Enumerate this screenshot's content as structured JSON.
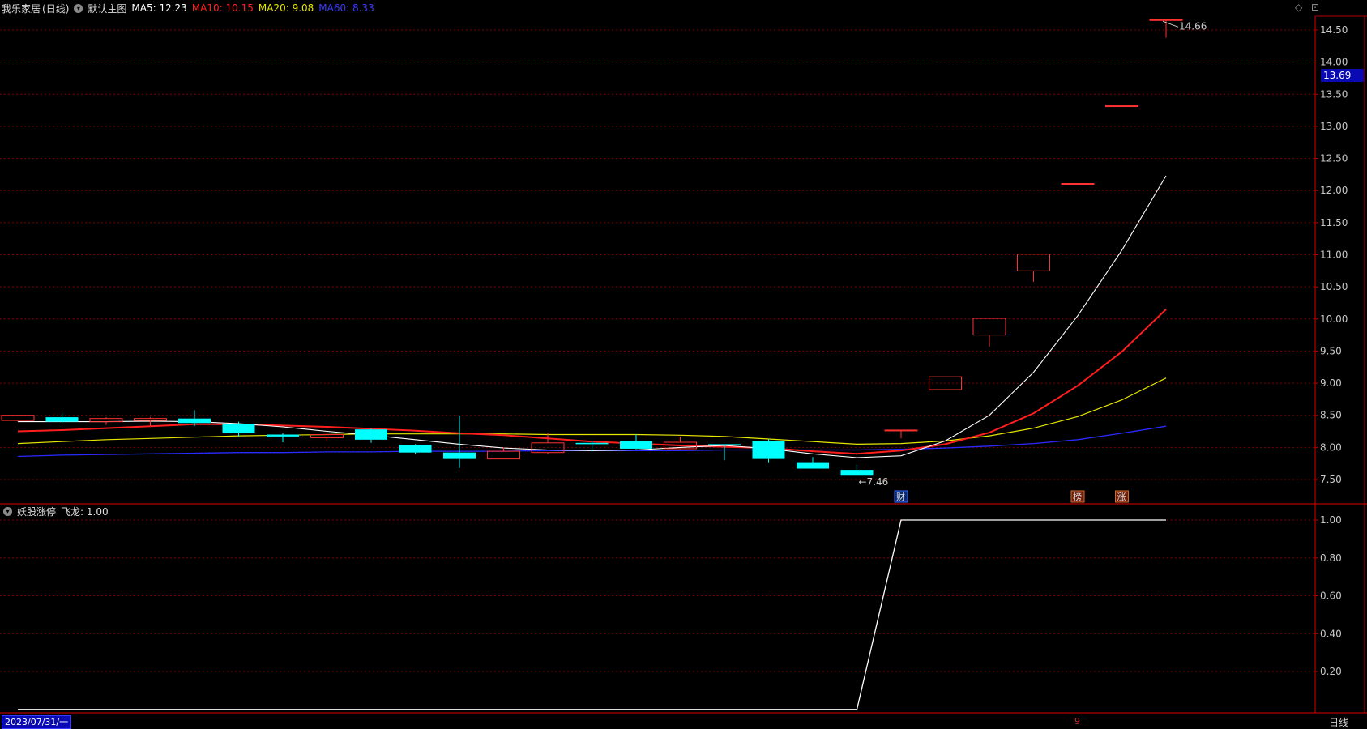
{
  "header": {
    "stock": "我乐家居",
    "period": "(日线)",
    "template": "默认主图",
    "ma5": "MA5: 12.23",
    "ma10": "MA10: 10.15",
    "ma20": "MA20: 9.08",
    "ma60": "MA60: 8.33"
  },
  "sub_header": {
    "indicator": "妖股涨停",
    "value": "飞龙: 1.00"
  },
  "corner_icons": {
    "left": "◇",
    "right": "⊡"
  },
  "current_price": "13.69",
  "footer": {
    "date": "2023/07/31/一",
    "period_label": "日线",
    "marker": "9"
  },
  "colors": {
    "up": "#ff3232",
    "down": "#00ffff",
    "ma5": "#ffffff",
    "ma10": "#ff1e1e",
    "ma20": "#e6e600",
    "ma60": "#2a2aff",
    "grid": "#7a0000",
    "border": "#b40000"
  },
  "chart_data": [
    {
      "type": "candlestick",
      "title": "我乐家居 (日线)",
      "ylim": [
        7.2,
        14.8
      ],
      "yticks": [
        "14.50",
        "14.00",
        "13.50",
        "13.00",
        "12.50",
        "12.00",
        "11.50",
        "11.00",
        "10.50",
        "10.00",
        "9.50",
        "9.00",
        "8.50",
        "8.00",
        "7.50"
      ],
      "candles": [
        {
          "o": 8.42,
          "h": 8.5,
          "l": 8.4,
          "c": 8.5
        },
        {
          "o": 8.47,
          "h": 8.53,
          "l": 8.38,
          "c": 8.4
        },
        {
          "o": 8.4,
          "h": 8.47,
          "l": 8.35,
          "c": 8.45
        },
        {
          "o": 8.42,
          "h": 8.47,
          "l": 8.33,
          "c": 8.45
        },
        {
          "o": 8.45,
          "h": 8.58,
          "l": 8.33,
          "c": 8.38
        },
        {
          "o": 8.37,
          "h": 8.4,
          "l": 8.17,
          "c": 8.22
        },
        {
          "o": 8.2,
          "h": 8.22,
          "l": 8.08,
          "c": 8.17
        },
        {
          "o": 8.15,
          "h": 8.23,
          "l": 8.1,
          "c": 8.2
        },
        {
          "o": 8.28,
          "h": 8.3,
          "l": 8.07,
          "c": 8.12
        },
        {
          "o": 8.04,
          "h": 8.05,
          "l": 7.9,
          "c": 7.92
        },
        {
          "o": 7.92,
          "h": 8.5,
          "l": 7.68,
          "c": 7.82
        },
        {
          "o": 7.82,
          "h": 8.0,
          "l": 7.82,
          "c": 7.94
        },
        {
          "o": 7.92,
          "h": 8.23,
          "l": 7.9,
          "c": 8.07
        },
        {
          "o": 8.07,
          "h": 8.1,
          "l": 7.93,
          "c": 8.05
        },
        {
          "o": 8.1,
          "h": 8.2,
          "l": 7.97,
          "c": 7.98
        },
        {
          "o": 7.98,
          "h": 8.17,
          "l": 7.97,
          "c": 8.08
        },
        {
          "o": 8.05,
          "h": 8.05,
          "l": 7.8,
          "c": 8.03
        },
        {
          "o": 8.1,
          "h": 8.13,
          "l": 7.77,
          "c": 7.82
        },
        {
          "o": 7.77,
          "h": 7.85,
          "l": 7.67,
          "c": 7.67
        },
        {
          "o": 7.65,
          "h": 7.73,
          "l": 7.56,
          "c": 7.56
        },
        {
          "o": 8.27,
          "h": 8.27,
          "l": 8.14,
          "c": 8.27
        },
        {
          "o": 8.9,
          "h": 9.1,
          "l": 8.9,
          "c": 9.1
        },
        {
          "o": 9.75,
          "h": 10.01,
          "l": 9.57,
          "c": 10.01
        },
        {
          "o": 10.75,
          "h": 11.01,
          "l": 10.58,
          "c": 11.01
        },
        {
          "o": 12.11,
          "h": 12.11,
          "l": 12.11,
          "c": 12.11
        },
        {
          "o": 13.32,
          "h": 13.32,
          "l": 13.32,
          "c": 13.32
        },
        {
          "o": 14.66,
          "h": 14.66,
          "l": 14.38,
          "c": 14.66
        }
      ],
      "ma5": [
        8.4,
        8.4,
        8.4,
        8.41,
        8.4,
        8.37,
        8.32,
        8.25,
        8.19,
        8.12,
        8.05,
        7.99,
        7.96,
        7.95,
        7.96,
        8.0,
        8.03,
        7.98,
        7.9,
        7.84,
        7.87,
        8.1,
        8.5,
        9.17,
        10.05,
        11.07,
        12.23
      ],
      "ma10": [
        8.25,
        8.27,
        8.3,
        8.33,
        8.36,
        8.36,
        8.34,
        8.32,
        8.29,
        8.26,
        8.22,
        8.19,
        8.14,
        8.09,
        8.06,
        8.03,
        8.01,
        7.99,
        7.94,
        7.9,
        7.95,
        8.05,
        8.23,
        8.53,
        8.96,
        9.49,
        10.15
      ],
      "ma20": [
        8.06,
        8.09,
        8.12,
        8.14,
        8.16,
        8.18,
        8.19,
        8.2,
        8.21,
        8.21,
        8.21,
        8.21,
        8.2,
        8.2,
        8.2,
        8.19,
        8.17,
        8.13,
        8.09,
        8.05,
        8.06,
        8.1,
        8.18,
        8.3,
        8.48,
        8.74,
        9.08
      ],
      "ma60": [
        7.86,
        7.88,
        7.89,
        7.9,
        7.91,
        7.92,
        7.92,
        7.93,
        7.93,
        7.94,
        7.94,
        7.94,
        7.95,
        7.95,
        7.95,
        7.95,
        7.96,
        7.96,
        7.96,
        7.96,
        7.97,
        7.99,
        8.02,
        8.06,
        8.12,
        8.22,
        8.33
      ],
      "annotations": [
        {
          "label": "←7.46",
          "index": 19
        },
        {
          "label": "14.66",
          "index": 26
        }
      ],
      "event_markers": [
        {
          "label": "财",
          "index": 20
        },
        {
          "label": "榜",
          "index": 24
        },
        {
          "label": "涨",
          "index": 25
        }
      ]
    },
    {
      "type": "line",
      "title": "妖股涨停",
      "series": [
        {
          "name": "飞龙",
          "values": [
            0,
            0,
            0,
            0,
            0,
            0,
            0,
            0,
            0,
            0,
            0,
            0,
            0,
            0,
            0,
            0,
            0,
            0,
            0,
            0,
            1,
            1,
            1,
            1,
            1,
            1,
            1
          ]
        }
      ],
      "ylim": [
        0,
        1.05
      ],
      "yticks": [
        "1.00",
        "0.80",
        "0.60",
        "0.40",
        "0.20"
      ]
    }
  ]
}
